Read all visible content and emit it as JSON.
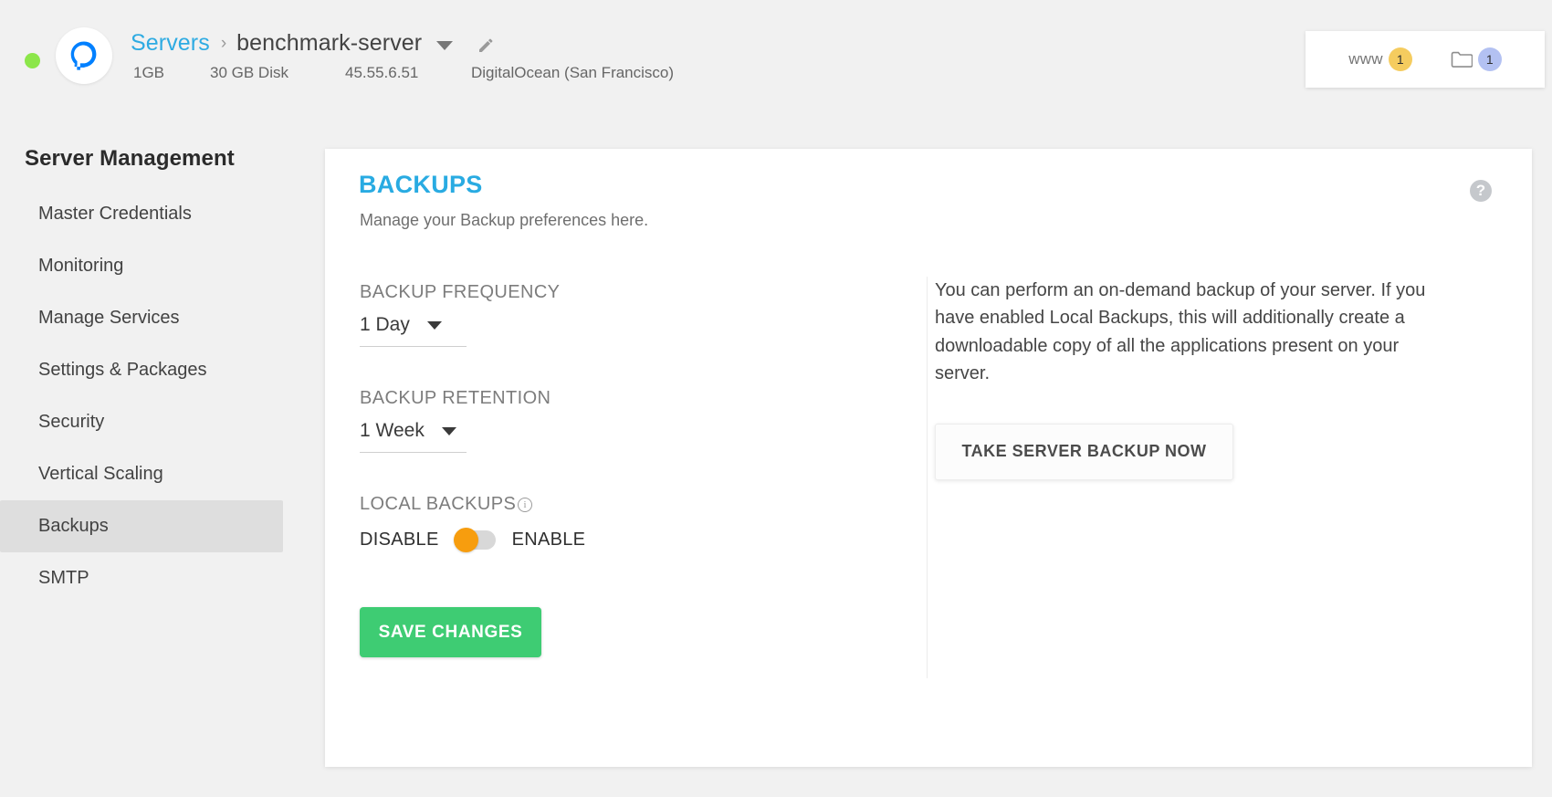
{
  "header": {
    "status": "online",
    "provider_icon": "digitalocean-logo",
    "breadcrumb": {
      "root": "Servers",
      "separator": "›",
      "current": "benchmark-server"
    },
    "meta": {
      "ram": "1GB",
      "disk": "30 GB Disk",
      "ip": "45.55.6.51",
      "provider": "DigitalOcean (San Francisco)"
    },
    "counters": [
      {
        "label": "www",
        "count": "1",
        "color": "#f5cc5f"
      },
      {
        "label": "folder-icon",
        "count": "1",
        "color": "#b3c1f2"
      }
    ]
  },
  "sidebar": {
    "title": "Server Management",
    "items": [
      {
        "label": "Master Credentials",
        "active": false
      },
      {
        "label": "Monitoring",
        "active": false
      },
      {
        "label": "Manage Services",
        "active": false
      },
      {
        "label": "Settings & Packages",
        "active": false
      },
      {
        "label": "Security",
        "active": false
      },
      {
        "label": "Vertical Scaling",
        "active": false
      },
      {
        "label": "Backups",
        "active": true
      },
      {
        "label": "SMTP",
        "active": false
      }
    ]
  },
  "main": {
    "title": "BACKUPS",
    "subtitle": "Manage your Backup preferences here.",
    "help_label": "?",
    "fields": {
      "frequency_label": "BACKUP FREQUENCY",
      "frequency_value": "1 Day",
      "retention_label": "BACKUP RETENTION",
      "retention_value": "1 Week",
      "local_backups_label": "LOCAL BACKUPS",
      "toggle_off_label": "DISABLE",
      "toggle_on_label": "ENABLE",
      "toggle_state": "disabled"
    },
    "save_label": "SAVE CHANGES",
    "right_panel": {
      "description": "You can perform an on-demand backup of your server. If you have enabled Local Backups, this will additionally create a downloadable copy of all the applications present on your server.",
      "action_label": "TAKE SERVER BACKUP NOW"
    }
  },
  "colors": {
    "accent_blue": "#29abe2",
    "save_green": "#3ecc73",
    "toggle_orange": "#f79d0e",
    "status_green": "#8ce64a"
  }
}
